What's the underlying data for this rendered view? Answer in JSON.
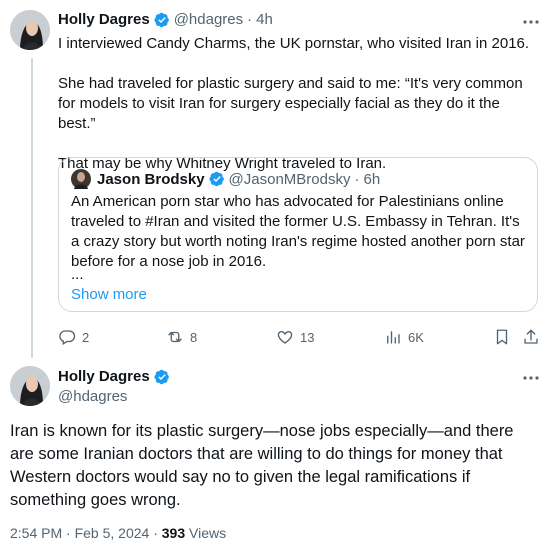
{
  "parent_tweet": {
    "author_name": "Holly Dagres",
    "handle": "@hdagres",
    "separator": "·",
    "time": "4h",
    "paragraphs": [
      "I interviewed Candy Charms, the UK pornstar, who visited Iran in 2016.",
      "She had traveled for plastic surgery and said to me: “It's very common for models to visit Iran for surgery especially facial as they do it the best.”",
      "That may be why Whitney Wright traveled to Iran."
    ],
    "actions": {
      "reply_count": "2",
      "repost_count": "8",
      "like_count": "13",
      "views_count": "6K"
    }
  },
  "quoted_tweet": {
    "author_name": "Jason Brodsky",
    "handle": "@JasonMBrodsky",
    "separator": "·",
    "time": "6h",
    "text": "An American porn star who has advocated for Palestinians online traveled to #Iran and visited the former U.S. Embassy in Tehran. It's a crazy story but worth noting Iran's regime hosted another porn star before for a nose job in 2016.",
    "ellipsis": "...",
    "show_more": "Show more"
  },
  "main_tweet": {
    "author_name": "Holly Dagres",
    "handle": "@hdagres",
    "text": "Iran is known for its plastic surgery—nose jobs especially—and there are some Iranian doctors that are willing to do things for money that Western doctors would say no to given the legal ramifications if something goes wrong.",
    "timestamp": "2:54 PM · Feb 5, 2024 · ",
    "views_count": "393",
    "views_label": "Views"
  },
  "colors": {
    "verified": "#1d9bf0",
    "link": "#1d9bf0",
    "muted": "#536471",
    "border": "#cfd9de"
  }
}
